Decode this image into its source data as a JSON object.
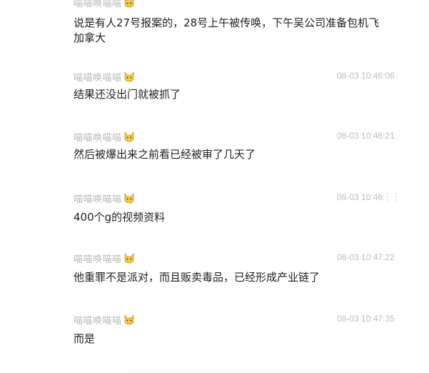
{
  "comments": [
    {
      "user": "喵喵唤喵喵",
      "time": "",
      "text_lines": [
        "说是有人27号报案的，28号上午被传唤，下午吴公司准备包机飞",
        "加拿大"
      ]
    },
    {
      "user": "喵喵唤喵喵",
      "time": "08-03 10:46:06",
      "text_lines": [
        "结果还没出门就被抓了"
      ]
    },
    {
      "user": "喵喵唤喵喵",
      "time": "08-03 10:46:21",
      "text_lines": [
        "然后被爆出来之前看已经被审了几天了"
      ]
    },
    {
      "user": "喵喵唤喵喵",
      "time": "08-03 10:46:",
      "text_lines": [
        "400个g的视频资料"
      ]
    },
    {
      "user": "喵喵唤喵喵",
      "time": "08-03 10:47:22",
      "text_lines": [
        "他重罪不是派对，而且贩卖毒品，已经形成产业链了"
      ]
    },
    {
      "user": "喵喵唤喵喵",
      "time": "08-03 10:47:35",
      "text_lines": [
        "而是"
      ]
    }
  ],
  "icons": {
    "avatar_badge": "cat-face-icon",
    "more": "more-dots-icon"
  },
  "colors": {
    "username": "#b8b8b8",
    "timestamp": "#bdbdbd",
    "text": "#222222",
    "badge": "#f2c94c"
  }
}
